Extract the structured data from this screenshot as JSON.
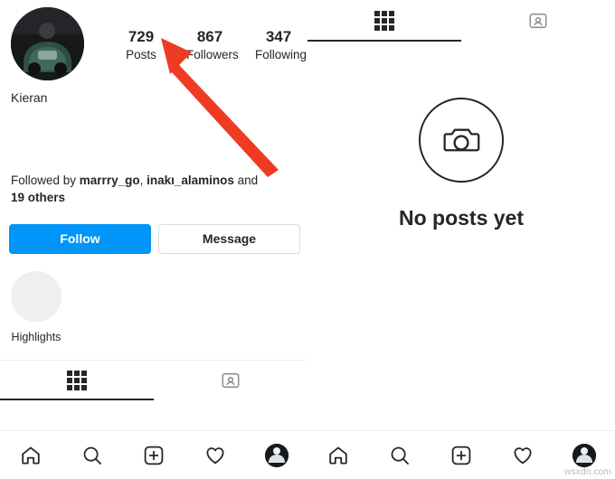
{
  "profile": {
    "username": "Kieran",
    "avatar_alt": "profile-picture",
    "stats": [
      {
        "value": "729",
        "label": "Posts"
      },
      {
        "value": "867",
        "label": "Followers"
      },
      {
        "value": "347",
        "label": "Following"
      }
    ],
    "followed_by": {
      "prefix": "Followed by ",
      "user1": "marrry_go",
      "separator": ", ",
      "user2": "inakı_alaminos",
      "suffix": " and",
      "line2": "19 others"
    },
    "buttons": {
      "follow": "Follow",
      "message": "Message"
    },
    "highlights_label": "Highlights"
  },
  "tabs_left": [
    {
      "name": "grid",
      "icon": "grid-icon",
      "active": true
    },
    {
      "name": "tagged",
      "icon": "tagged-person-icon",
      "active": false
    }
  ],
  "tabs_right": [
    {
      "name": "grid",
      "icon": "grid-icon",
      "active": true
    },
    {
      "name": "tagged",
      "icon": "tagged-person-icon",
      "active": false
    }
  ],
  "empty_state": {
    "icon": "camera-icon",
    "title": "No posts yet"
  },
  "bottom_nav": [
    {
      "name": "home",
      "icon": "home-icon"
    },
    {
      "name": "search",
      "icon": "search-icon"
    },
    {
      "name": "create",
      "icon": "plus-square-icon"
    },
    {
      "name": "activity",
      "icon": "heart-icon"
    },
    {
      "name": "profile",
      "icon": "avatar-icon"
    }
  ],
  "annotation": {
    "type": "arrow",
    "color": "#ee3b24",
    "points_to": "Posts stat"
  },
  "watermark": "wsxdn.com",
  "colors": {
    "accent_blue": "#0095f6",
    "text": "#262626",
    "muted": "#8e8e8e",
    "border": "#dbdbdb",
    "arrow_red": "#ee3b24"
  }
}
